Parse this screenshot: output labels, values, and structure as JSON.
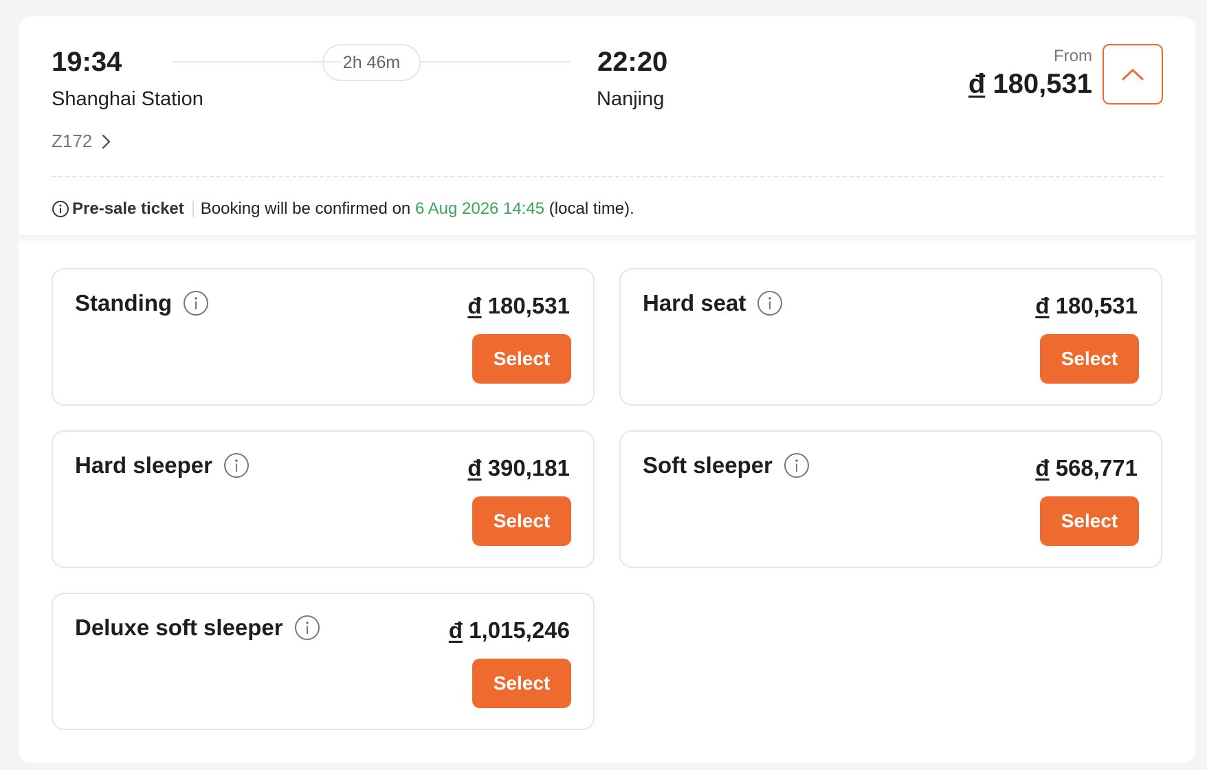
{
  "trip": {
    "departure_time": "19:34",
    "departure_station": "Shanghai Station",
    "duration": "2h 46m",
    "arrival_time": "22:20",
    "arrival_station": "Nanjing",
    "train_number": "Z172",
    "from_label": "From",
    "currency_symbol": "đ",
    "from_price": "180,531"
  },
  "notice": {
    "presale_label": "Pre-sale ticket",
    "text_before": "Booking will be confirmed on",
    "date": "6 Aug 2026 14:45",
    "text_after": "(local time)."
  },
  "select_label": "Select",
  "seats": [
    {
      "name": "Standing",
      "price": "180,531"
    },
    {
      "name": "Hard seat",
      "price": "180,531"
    },
    {
      "name": "Hard sleeper",
      "price": "390,181"
    },
    {
      "name": "Soft sleeper",
      "price": "568,771"
    },
    {
      "name": "Deluxe soft sleeper",
      "price": "1,015,246"
    }
  ],
  "colors": {
    "accent": "#ef6a2f",
    "date_green": "#3aa55c"
  }
}
